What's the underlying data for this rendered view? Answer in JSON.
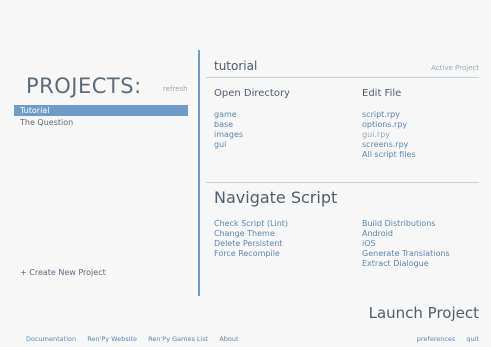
{
  "projects": {
    "title": "PROJECTS:",
    "refresh_label": "refresh",
    "items": [
      {
        "label": "Tutorial",
        "selected": true
      },
      {
        "label": "The Question",
        "selected": false
      }
    ],
    "create_label": "+ Create New Project"
  },
  "project": {
    "name": "tutorial",
    "active_label": "Active Project"
  },
  "open_directory": {
    "title": "Open Directory",
    "links": [
      "game",
      "base",
      "images",
      "gui"
    ]
  },
  "edit_file": {
    "title": "Edit File",
    "links": [
      "script.rpy",
      "options.rpy",
      "gui.rpy",
      "screens.rpy",
      "All script files"
    ],
    "disabled_index": 2
  },
  "navigate": {
    "title": "Navigate Script",
    "left_links": [
      "Check Script (Lint)",
      "Change Theme",
      "Delete Persistent",
      "Force Recompile"
    ],
    "right_links": [
      "Build Distributions",
      "Android",
      "iOS",
      "Generate Translations",
      "Extract Dialogue"
    ]
  },
  "launch_label": "Launch Project",
  "footer": {
    "left": [
      "Documentation",
      "Ren'Py Website",
      "Ren'Py Games List",
      "About"
    ],
    "right": [
      "preferences",
      "quit"
    ]
  },
  "colors": {
    "accent": "#6f9bc7",
    "link": "#5b86b3",
    "text": "#4f5e6d",
    "background": "#f7f7f7"
  }
}
